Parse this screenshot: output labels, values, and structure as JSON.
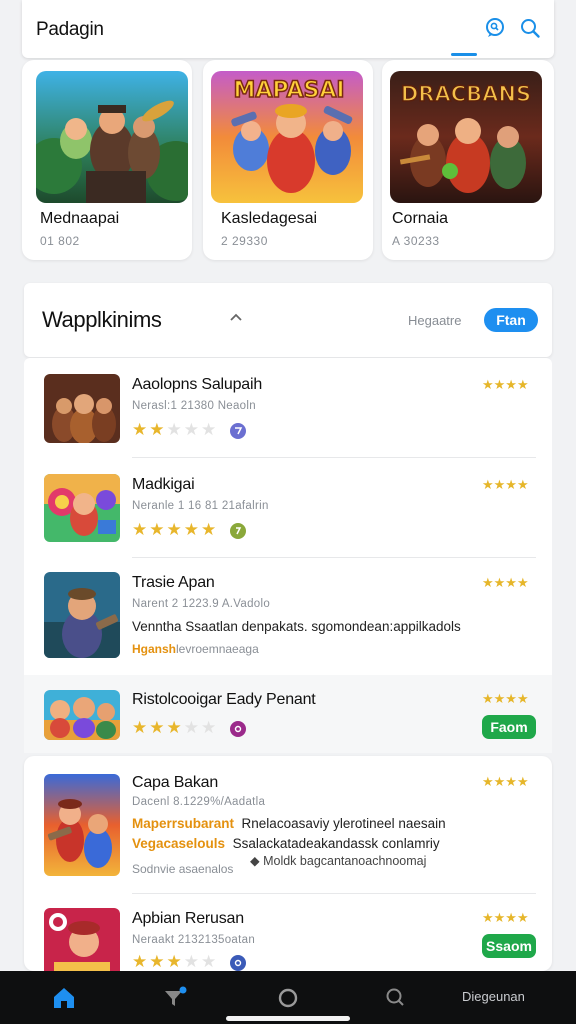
{
  "header": {
    "title": "Padagin",
    "icons": [
      "chat-search-icon",
      "search-icon"
    ]
  },
  "featured": [
    {
      "name": "Mednaapai",
      "sub": "01 802",
      "art": "forest-heroes"
    },
    {
      "name": "Kasledagesai",
      "sub": "2 29330",
      "art": "mapasai"
    },
    {
      "name": "Cornaia",
      "sub": "A 30233",
      "art": "dracbans"
    }
  ],
  "featured_titles": [
    "MAPASAI",
    "DRACBANS"
  ],
  "section": {
    "title": "Wapplkinims",
    "link": "Hegaatre",
    "button": "Ftan"
  },
  "apps": [
    {
      "name": "Aaolopns Salupaih",
      "meta": "Nerasl:1  21380  Neaoln",
      "rating": 2,
      "stars_right": "★★★★",
      "badge_color": "#6b6fd1"
    },
    {
      "name": "Madkigai",
      "meta": "Neranle 1  16  81  21afalrin",
      "rating": 5,
      "stars_right": "★★★★",
      "badge_color": "#8aa83a"
    },
    {
      "name": "Trasie Apan",
      "meta": "Narent 2  1223.9 A.Vadolo",
      "desc": "Venntha Ssaatlan denpakats. sgomondean:appilkadols",
      "tag_accent": "Hgansh",
      "tag_rest": "levroemnaeaga",
      "stars_right": "★★★★"
    },
    {
      "name": "Ristolcooigar Eady Penant",
      "rating": 3,
      "stars_right": "★★★★",
      "button": "Faom",
      "badge_color": "#9b2a8b"
    },
    {
      "name": "Capa Bakan",
      "meta": "Dacenl 8.1229%/Aadatla",
      "desc1_accent": "Maperrsubarant",
      "desc1": "Rnelacoasaviy ylerotineel naesain",
      "desc2_accent": "Vegacaselouls",
      "desc2": "Ssalackatadeakandassk conlamriy",
      "note": "Moldk bagcantanoachnoomaj",
      "tag": "Sodnvie asaenalos",
      "stars_right": "★★★★"
    },
    {
      "name": "Apbian Rerusan",
      "meta": "Neraakt  2132135oatan",
      "rating": 3,
      "stars_right": "★★★★",
      "button": "Ssaom",
      "badge_color": "#3b5bb8"
    }
  ],
  "bottom_nav": {
    "label": "Diegeunan",
    "icons": [
      "home-icon",
      "filter-icon",
      "circle-icon",
      "search-icon"
    ]
  },
  "colors": {
    "accent": "#1e8ff0",
    "install": "#1fa84a",
    "star": "#e8b62c",
    "tag": "#e4910f"
  }
}
